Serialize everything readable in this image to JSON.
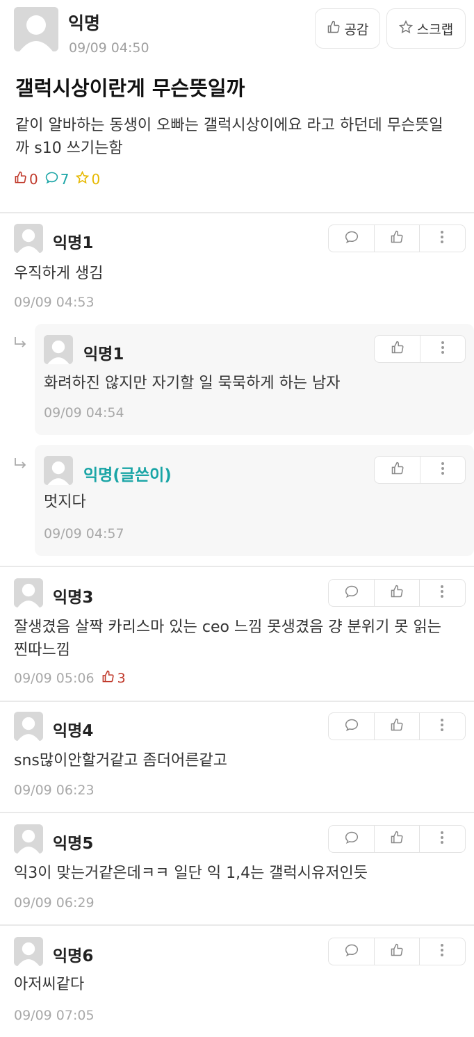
{
  "post": {
    "author": "익명",
    "time": "09/09 04:50",
    "empathy_label": "공감",
    "scrap_label": "스크랩",
    "title": "갤럭시상이란게 무슨뜻일까",
    "body": "같이 알바하는 동생이 오빠는 갤럭시상이에요 라고 하던데 무슨뜻일까 s10 쓰기는함",
    "likes": "0",
    "comments": "7",
    "scraps": "0"
  },
  "comments": [
    {
      "author": "익명1",
      "text": "우직하게 생김",
      "time": "09/09 04:53"
    },
    {
      "author": "익명3",
      "text": "잘생겼음 살짝 카리스마 있는 ceo 느낌 못생겼음 걍 분위기 못 읽는 찐따느낌",
      "time": "09/09 05:06",
      "votes": "3"
    },
    {
      "author": "익명4",
      "text": "sns많이안할거같고 좀더어른같고",
      "time": "09/09 06:23"
    },
    {
      "author": "익명5",
      "text": "익3이 맞는거같은데ㅋㅋ 일단 익 1,4는 갤럭시유저인듯",
      "time": "09/09 06:29"
    },
    {
      "author": "익명6",
      "text": "아저씨같다",
      "time": "09/09 07:05"
    }
  ],
  "replies": [
    {
      "author": "익명1",
      "text": "화려하진 않지만 자기할 일 묵묵하게 하는 남자",
      "time": "09/09 04:54"
    },
    {
      "author": "익명(글쓴이)",
      "text": "멋지다",
      "time": "09/09 04:57"
    }
  ],
  "colors": {
    "like": "#c0392b",
    "comment": "#1aa5a6",
    "scrap": "#e6b800",
    "writer": "#1aa5a6"
  },
  "icons": [
    "avatar",
    "thumbs-up-icon",
    "star-icon",
    "comment-icon",
    "more-icon",
    "reply-arrow-icon"
  ]
}
